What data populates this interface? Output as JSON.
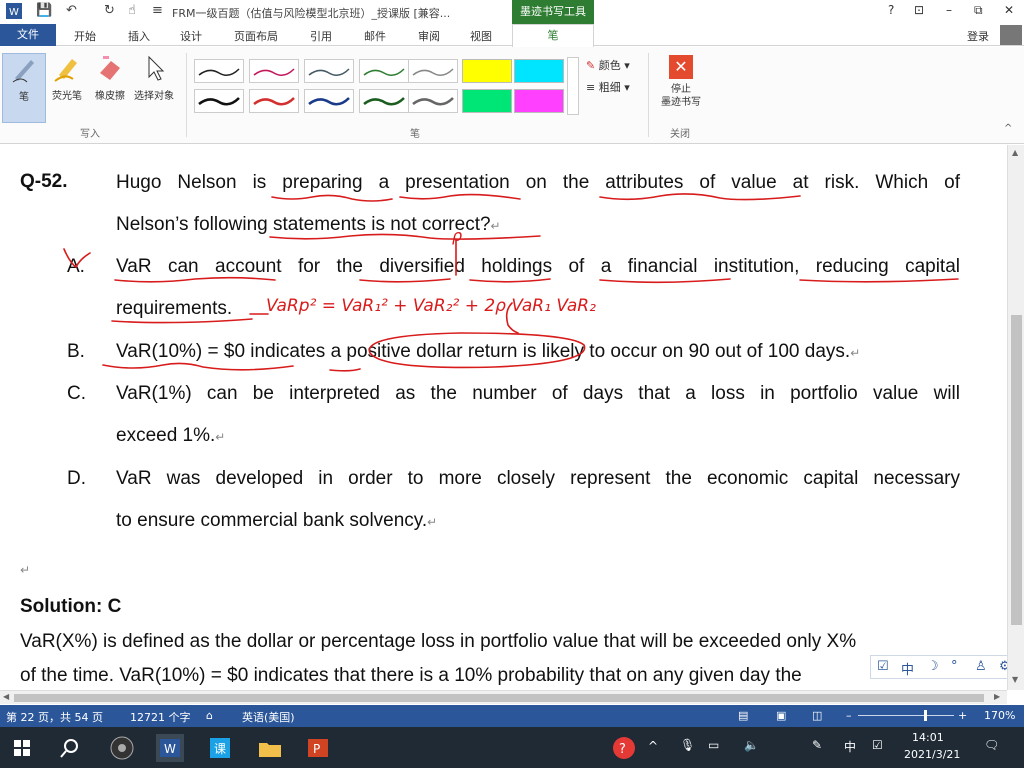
{
  "window": {
    "title": "FRM一级百题（估值与风险模型北京班）_授课版 [兼容...",
    "context_tab_group": "墨迹书写工具",
    "controls": {
      "help": "?",
      "ribbon_opts": "⊡",
      "minimize": "–",
      "restore": "⧉",
      "close": "✕"
    }
  },
  "ribbon": {
    "tabs": [
      "开始",
      "插入",
      "设计",
      "页面布局",
      "引用",
      "邮件",
      "审阅",
      "视图"
    ],
    "file_tab": "文件",
    "active_tab": "笔",
    "login": "登录",
    "tools": [
      "笔",
      "荧光笔",
      "橡皮擦",
      "选择对象"
    ],
    "write_group_label": "写入",
    "pen_group_label": "笔",
    "color_label": "颜色",
    "thickness_label": "粗细",
    "stop_label_1": "停止",
    "stop_label_2": "墨迹书写",
    "close_group_label": "关闭",
    "pen_colors_top": [
      "#222222",
      "#c2185b",
      "#455a64",
      "#2e7d32",
      "#888888"
    ],
    "pen_colors_bottom": [
      "#111111",
      "#d32f2f",
      "#1a3a8a",
      "#1b5e20",
      "#666666"
    ],
    "highlighters_top": [
      "#ffff00",
      "#00e5ff"
    ],
    "highlighters_bottom": [
      "#00e676",
      "#ff40ff"
    ]
  },
  "document": {
    "question_number": "Q-52.",
    "question_line1": "Hugo Nelson is preparing a presentation on the attributes of value at risk. Which of",
    "question_line2": "Nelson’s following statements is not correct?",
    "options": [
      {
        "label": "A.",
        "text_line1": "VaR can account for the diversified holdings of a financial institution, reducing capital",
        "text_line2": "requirements."
      },
      {
        "label": "B.",
        "text_line1": "VaR(10%) = $0 indicates a positive dollar return is likely to occur on 90 out of 100 days."
      },
      {
        "label": "C.",
        "text_line1": "VaR(1%) can be interpreted as the number of days that a loss in portfolio value will",
        "text_line2": "exceed 1%."
      },
      {
        "label": "D.",
        "text_line1": "VaR was developed in order to more closely represent the economic capital necessary",
        "text_line2": "to ensure commercial bank solvency."
      }
    ],
    "solution_title": "Solution: C",
    "solution_line1": "VaR(X%) is defined as the dollar or percentage loss in portfolio value that will be exceeded only X%",
    "solution_line2": "of the time.  VaR(10%) = $0  indicates that there is a 10% probability that on any given day the",
    "handwritten_formula": "VaRp² = VaR₁² + VaR₂² + 2ρ VaR₁ VaR₂",
    "handwritten_rho": "ρ"
  },
  "statusbar": {
    "page": "第 22 页，共 54 页",
    "words": "12721 个字",
    "language": "英语(美国)",
    "zoom": "170%",
    "zoom_level": 0.7
  },
  "taskbar": {
    "time": "14:01",
    "date": "2021/3/21",
    "ime": "中"
  },
  "floatbar": [
    "☑",
    "中",
    "☽",
    "°",
    "♙",
    "⚙"
  ]
}
